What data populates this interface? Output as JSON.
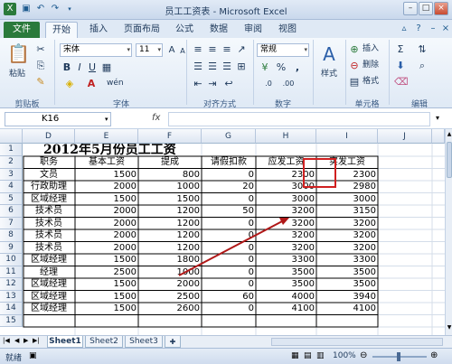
{
  "window": {
    "title": "员工工资表 - Microsoft Excel"
  },
  "tabs": [
    "文件",
    "开始",
    "插入",
    "页面布局",
    "公式",
    "数据",
    "审阅",
    "视图"
  ],
  "ribbon": {
    "paste_label": "粘贴",
    "clipboard_group": "剪贴板",
    "font_name": "宋体",
    "font_size": "11",
    "font_group": "字体",
    "align_group": "对齐方式",
    "number_format": "常规",
    "number_group": "数字",
    "style_label": "样式",
    "insert_label": "插入",
    "delete_label": "删除",
    "format_label": "格式",
    "cells_group": "单元格",
    "edit_group": "编辑"
  },
  "formula_bar": {
    "name_box": "K16",
    "fx": "fx",
    "formula": ""
  },
  "columns": [
    "D",
    "E",
    "F",
    "G",
    "H",
    "I",
    "J"
  ],
  "rows": [
    "1",
    "2",
    "3",
    "4",
    "5",
    "6",
    "7",
    "8",
    "9",
    "10",
    "11",
    "12",
    "13",
    "14",
    "15"
  ],
  "sheet": {
    "title": "2012年5月份员工工资",
    "headers": [
      "职务",
      "基本工资",
      "提成",
      "请假扣款",
      "应发工资",
      "实发工资"
    ],
    "data": [
      [
        "文员",
        "1500",
        "800",
        "0",
        "2300",
        "2300"
      ],
      [
        "行政助理",
        "2000",
        "1000",
        "20",
        "3000",
        "2980"
      ],
      [
        "区域经理",
        "1500",
        "1500",
        "0",
        "3000",
        "3000"
      ],
      [
        "技术员",
        "2000",
        "1200",
        "50",
        "3200",
        "3150"
      ],
      [
        "技术员",
        "2000",
        "1200",
        "0",
        "3200",
        "3200"
      ],
      [
        "技术员",
        "2000",
        "1200",
        "0",
        "3200",
        "3200"
      ],
      [
        "技术员",
        "2000",
        "1200",
        "0",
        "3200",
        "3200"
      ],
      [
        "区域经理",
        "1500",
        "1800",
        "0",
        "3300",
        "3300"
      ],
      [
        "经理",
        "2500",
        "1000",
        "0",
        "3500",
        "3500"
      ],
      [
        "区域经理",
        "1500",
        "2000",
        "0",
        "3500",
        "3500"
      ],
      [
        "区域经理",
        "1500",
        "2500",
        "60",
        "4000",
        "3940"
      ],
      [
        "区域经理",
        "1500",
        "2600",
        "0",
        "4100",
        "4100"
      ]
    ]
  },
  "sheet_tabs": [
    "Sheet1",
    "Sheet2",
    "Sheet3"
  ],
  "status": {
    "ready": "就绪",
    "zoom": "100%"
  },
  "colors": {
    "file_tab": "#2a7a3b",
    "highlight": "#d02020",
    "arrow": "#b01818"
  }
}
